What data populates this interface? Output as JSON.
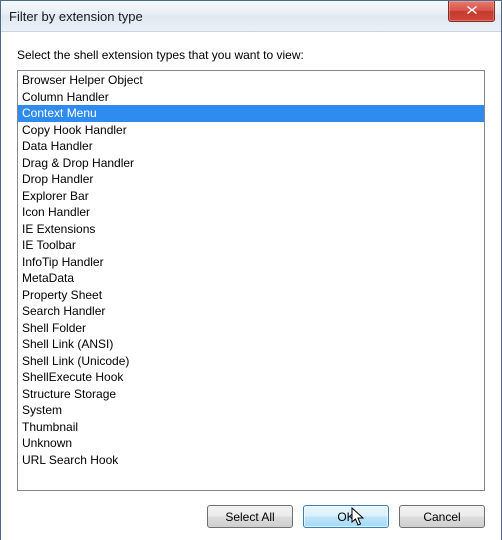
{
  "titlebar": {
    "title": "Filter by extension type"
  },
  "instruction": "Select the shell extension types that you want to view:",
  "list": {
    "selected_index": 2,
    "items": [
      "Browser Helper Object",
      "Column Handler",
      "Context Menu",
      "Copy Hook Handler",
      "Data Handler",
      "Drag & Drop Handler",
      "Drop Handler",
      "Explorer Bar",
      "Icon Handler",
      "IE Extensions",
      "IE Toolbar",
      "InfoTip Handler",
      "MetaData",
      "Property Sheet",
      "Search Handler",
      "Shell Folder",
      "Shell Link (ANSI)",
      "Shell Link (Unicode)",
      "ShellExecute Hook",
      "Structure Storage",
      "System",
      "Thumbnail",
      "Unknown",
      "URL Search Hook"
    ]
  },
  "buttons": {
    "select_all": "Select All",
    "ok": "OK",
    "cancel": "Cancel"
  }
}
